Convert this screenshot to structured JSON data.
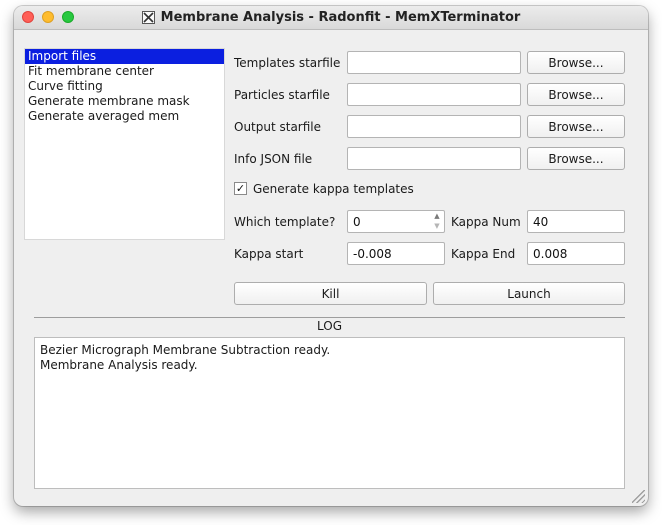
{
  "window": {
    "title": "Membrane Analysis - Radonfit - MemXTerminator"
  },
  "nav": {
    "items": [
      {
        "label": "Import files",
        "selected": true
      },
      {
        "label": "Fit membrane center",
        "selected": false
      },
      {
        "label": "Curve fitting",
        "selected": false
      },
      {
        "label": "Generate membrane mask",
        "selected": false
      },
      {
        "label": "Generate averaged mem",
        "selected": false
      }
    ]
  },
  "form": {
    "templates_label": "Templates starfile",
    "templates_value": "",
    "particles_label": "Particles starfile",
    "particles_value": "",
    "output_label": "Output starfile",
    "output_value": "",
    "info_json_label": "Info JSON file",
    "info_json_value": "",
    "browse_label": "Browse...",
    "kappa_templates_label": "Generate kappa templates",
    "kappa_templates_checked": true,
    "which_template_label": "Which template?",
    "which_template_value": "0",
    "kappa_num_label": "Kappa Num",
    "kappa_num_value": "40",
    "kappa_start_label": "Kappa start",
    "kappa_start_value": "-0.008",
    "kappa_end_label": "Kappa End",
    "kappa_end_value": "0.008"
  },
  "actions": {
    "kill_label": "Kill",
    "launch_label": "Launch"
  },
  "log": {
    "title": "LOG",
    "lines": [
      "Bezier Micrograph Membrane Subtraction ready.",
      "Membrane Analysis ready."
    ]
  },
  "icons": {
    "app_icon": "x11-icon",
    "checkmark": "✓",
    "spin_up": "▲",
    "spin_down": "▼"
  },
  "colors": {
    "selection": "#0b1fe0",
    "close": "#ff5f57",
    "minimize": "#febc2e",
    "maximize": "#28c840"
  }
}
